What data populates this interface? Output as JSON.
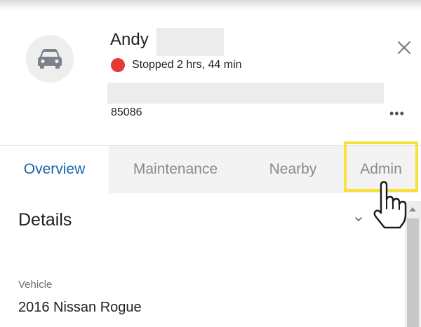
{
  "header": {
    "name": "Andy",
    "status_text": "Stopped 2 hrs, 44 min",
    "status_color": "#e53935",
    "zip": "85086",
    "more_label": "•••"
  },
  "tabs": [
    {
      "label": "Overview",
      "active": true
    },
    {
      "label": "Maintenance",
      "active": false
    },
    {
      "label": "Nearby",
      "active": false
    },
    {
      "label": "Admin",
      "active": false
    }
  ],
  "details": {
    "title": "Details",
    "field_label": "Vehicle",
    "field_value": "2016 Nissan Rogue"
  },
  "colors": {
    "accent": "#1565a8",
    "highlight": "#f5e23a"
  },
  "icons": [
    "car-icon",
    "close-icon",
    "chevron-down-icon",
    "hand-pointer-icon"
  ]
}
